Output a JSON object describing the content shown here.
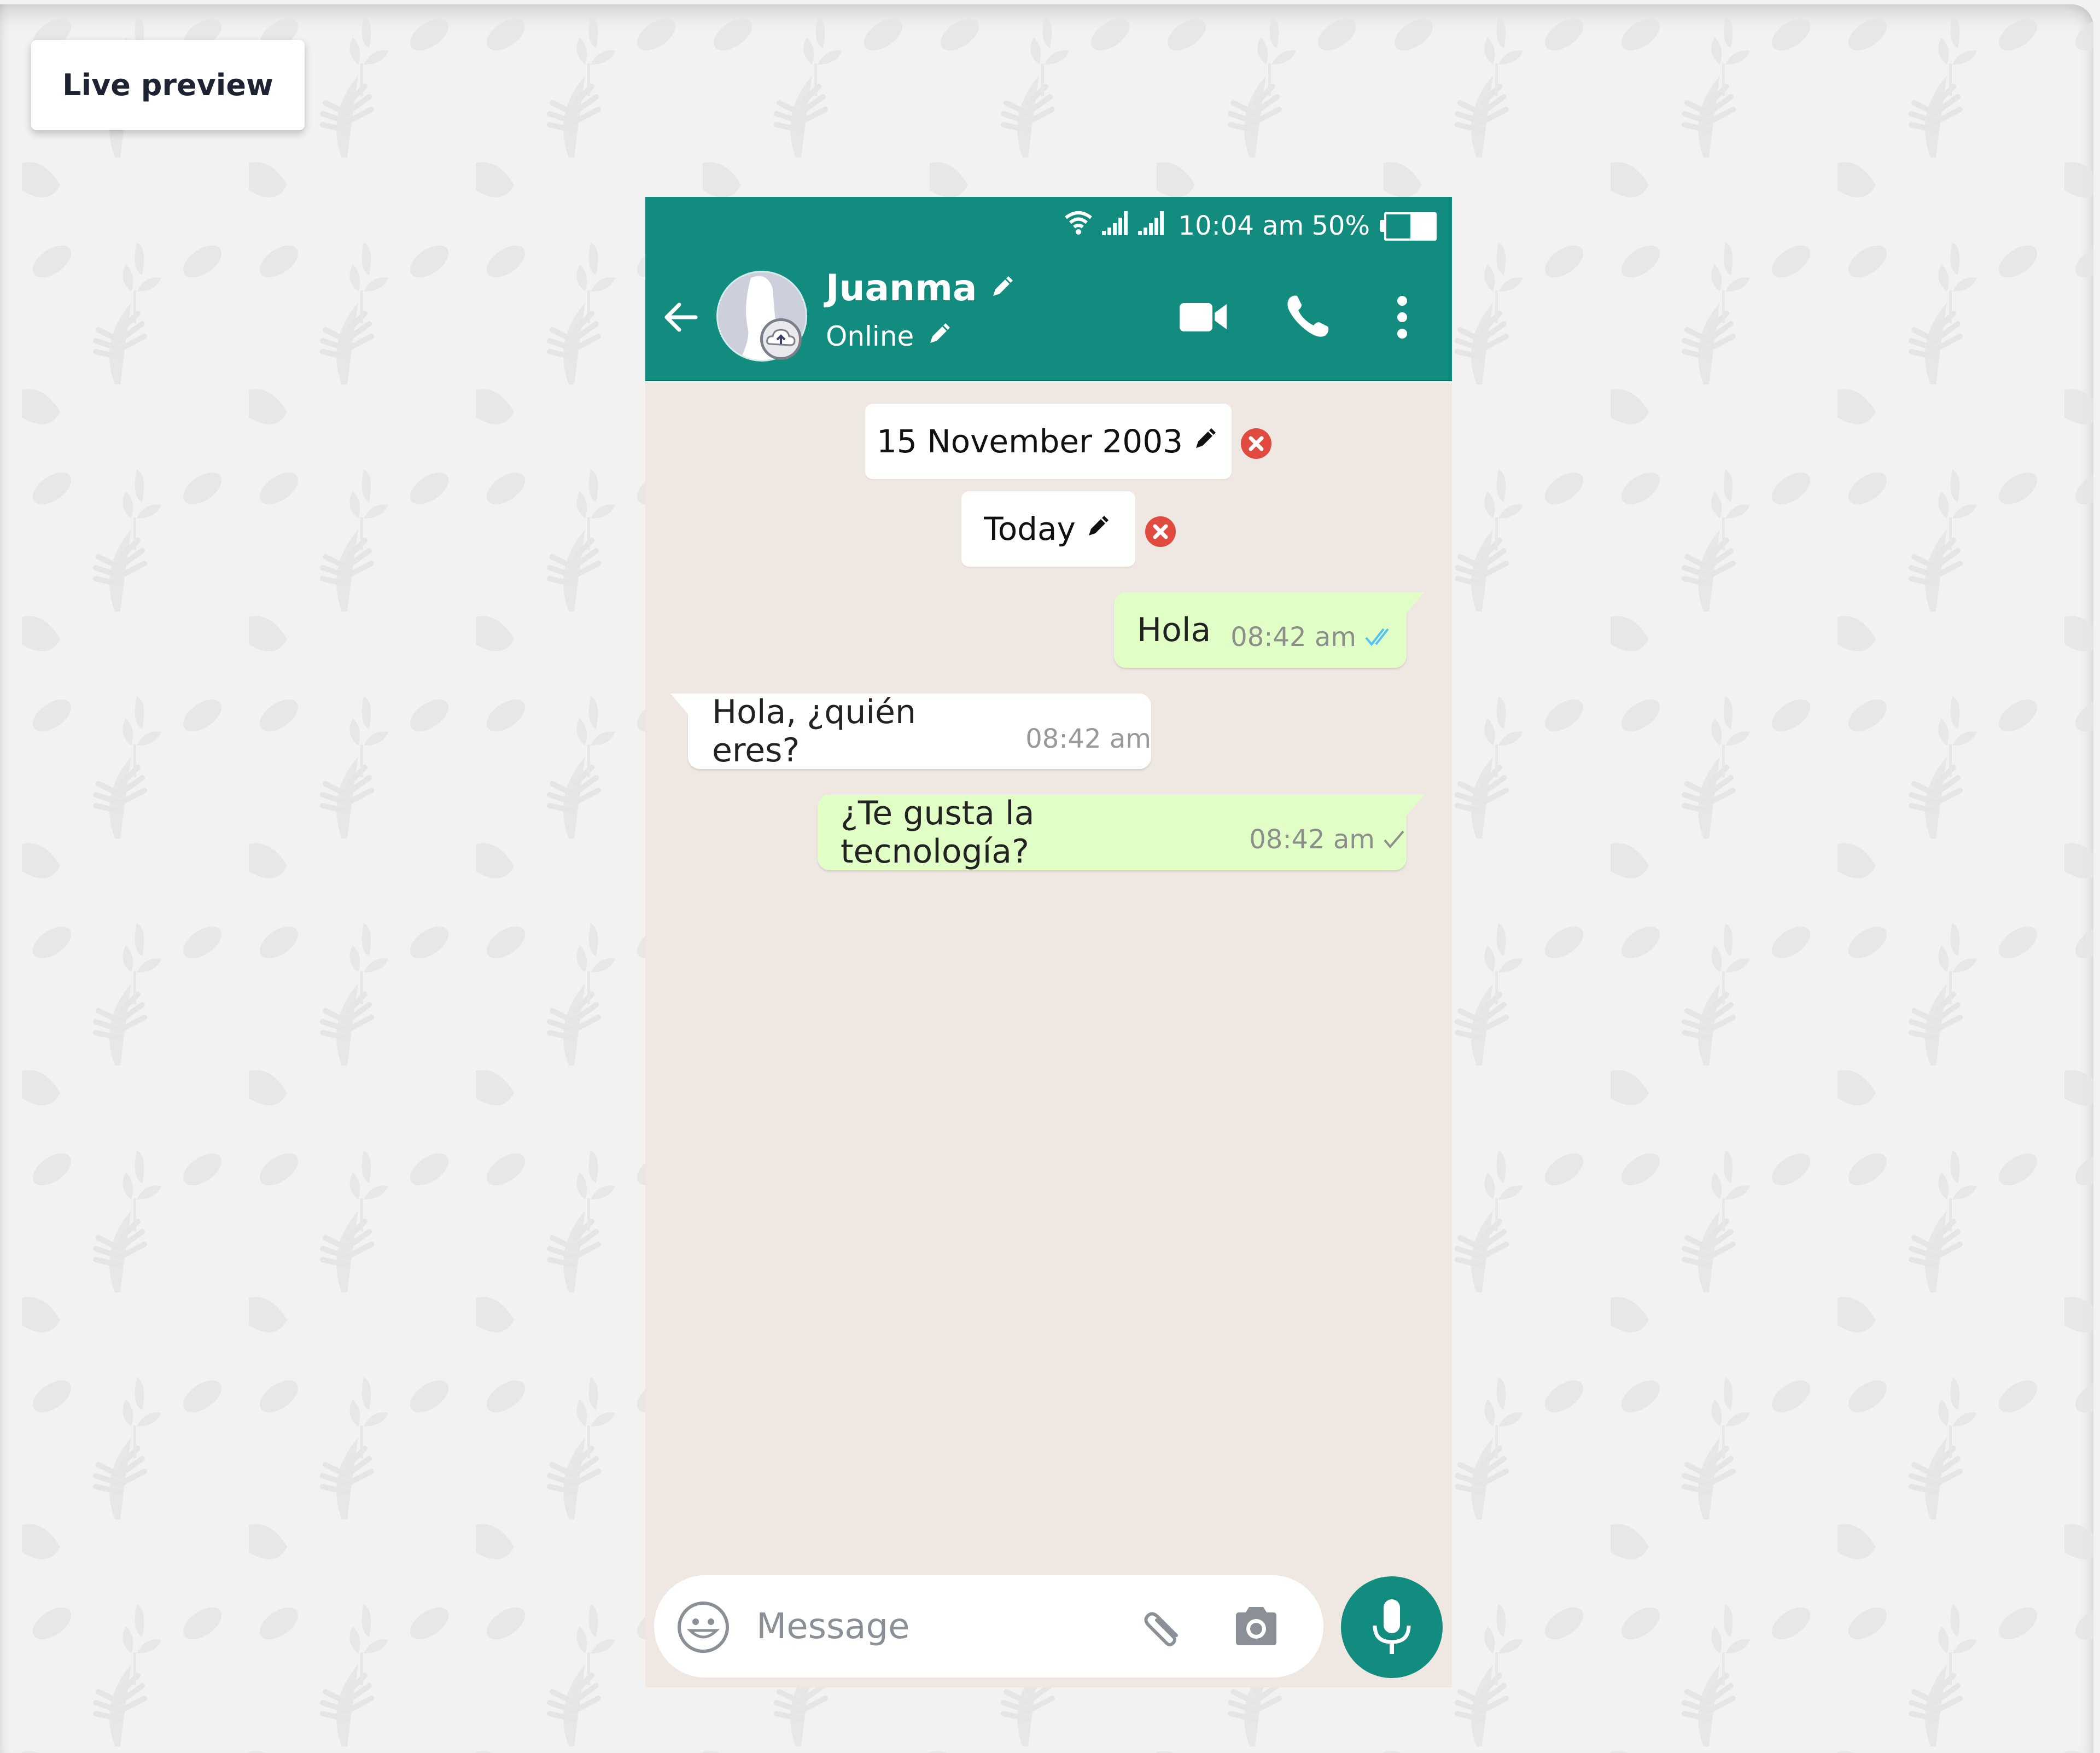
{
  "page": {
    "live_preview_label": "Live preview"
  },
  "status_bar": {
    "wifi_icon": "wifi-icon",
    "signal_icons": [
      "signal-icon",
      "signal-icon"
    ],
    "time": "10:04 am",
    "battery_percent_label": "50%",
    "battery_level": 0.5
  },
  "header": {
    "back_icon": "arrow-left-icon",
    "avatar_icon": "default-avatar",
    "upload_icon": "cloud-upload-icon",
    "contact_name": "Juanma",
    "contact_status": "Online",
    "edit_icon": "pencil-icon",
    "actions": [
      "video-call-icon",
      "phone-icon",
      "more-vertical-icon"
    ],
    "color": "#128c7e"
  },
  "chat": {
    "date_chips": [
      {
        "label": "15 November 2003"
      },
      {
        "label": "Today"
      }
    ],
    "messages": [
      {
        "direction": "out",
        "text": "Hola",
        "time": "08:42 am",
        "status": "read"
      },
      {
        "direction": "in",
        "text": "Hola, ¿quién eres?",
        "time": "08:42 am"
      },
      {
        "direction": "out",
        "text": "¿Te gusta la tecnología?",
        "time": "08:42 am",
        "status": "sent"
      }
    ],
    "outgoing_color": "#e1fec6",
    "incoming_color": "#ffffff",
    "read_tick_color": "#4fc3f7",
    "remove_color": "#e04a3f"
  },
  "composer": {
    "placeholder": "Message",
    "value": "",
    "emoji_icon": "emoji-icon",
    "attach_icon": "paperclip-icon",
    "camera_icon": "camera-icon",
    "mic_icon": "microphone-icon"
  }
}
